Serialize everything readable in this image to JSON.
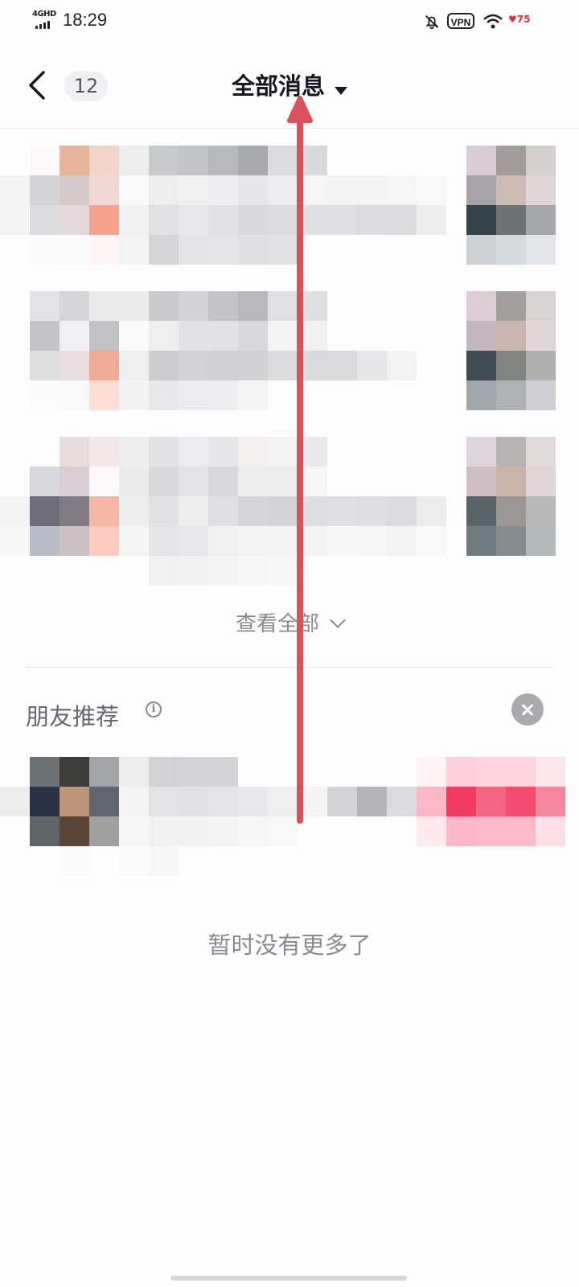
{
  "status_bar": {
    "network": "4GHD",
    "time": "18:29",
    "vpn": "VPN",
    "battery": "75"
  },
  "header": {
    "unread_count": "12",
    "title": "全部消息"
  },
  "messages": {
    "view_all": "查看全部"
  },
  "friends": {
    "title": "朋友推荐",
    "empty_text": "暂时没有更多了"
  },
  "icons": {
    "back": "chevron-left-icon",
    "title_dropdown": "caret-down-icon",
    "view_all": "chevron-down-icon",
    "info": "info-icon",
    "close": "close-icon"
  },
  "colors": {
    "arrow_overlay": "#d9515a",
    "secondary_text": "#8a8b91"
  }
}
